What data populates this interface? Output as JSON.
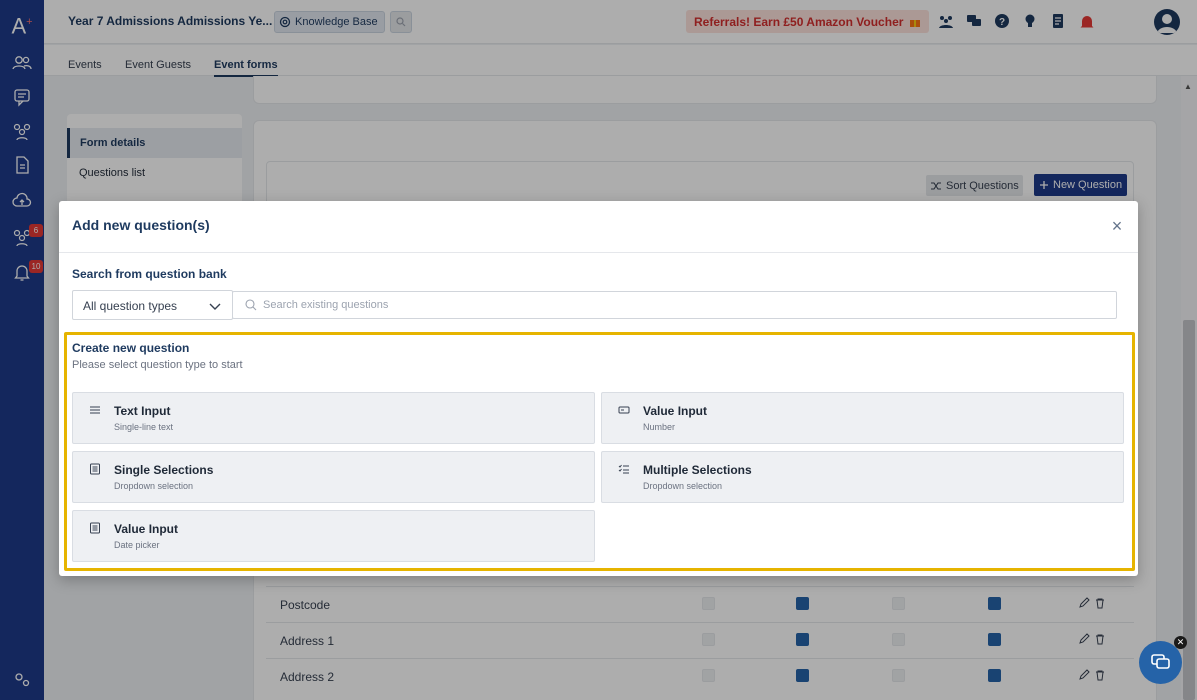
{
  "app": {
    "logo": "A",
    "logo_sup": "+",
    "title": "Year 7 Admissions Admissions Ye...",
    "knowledge_base": "Knowledge Base",
    "referral": "Referrals! Earn £50 Amazon Voucher"
  },
  "rail": {
    "badges": {
      "groups": "6",
      "notifications": "10"
    }
  },
  "subtabs": [
    "Events",
    "Event Guests",
    "Event forms"
  ],
  "side_menu": [
    "Form details",
    "Questions list"
  ],
  "toolbar": {
    "sort": "Sort Questions",
    "new_question": "New Question"
  },
  "table_rows": [
    {
      "label": "Postcode",
      "checks": [
        false,
        true,
        false,
        true
      ]
    },
    {
      "label": "Address 1",
      "checks": [
        false,
        true,
        false,
        true
      ]
    },
    {
      "label": "Address 2",
      "checks": [
        false,
        true,
        false,
        true
      ]
    }
  ],
  "modal": {
    "title": "Add new question(s)",
    "close": "×",
    "bank_title": "Search from question bank",
    "type_select": "All question types",
    "search_placeholder": "Search existing questions",
    "create_title": "Create new question",
    "create_sub": "Please select question type to start",
    "question_types": [
      {
        "title": "Text Input",
        "sub": "Single-line text",
        "icon": "lines-icon"
      },
      {
        "title": "Value Input",
        "sub": "Number",
        "icon": "number-field-icon"
      },
      {
        "title": "Single Selections",
        "sub": "Dropdown selection",
        "icon": "list-box-icon"
      },
      {
        "title": "Multiple Selections",
        "sub": "Dropdown selection",
        "icon": "checklist-icon"
      },
      {
        "title": "Value Input",
        "sub": "Date picker",
        "icon": "list-box-icon"
      }
    ]
  },
  "colors": {
    "rail": "#1e3a8a",
    "accent": "#1e3a5f",
    "highlight": "#e6b400",
    "referral_text": "#d32f2f",
    "checkbox_on": "#2563a8"
  }
}
